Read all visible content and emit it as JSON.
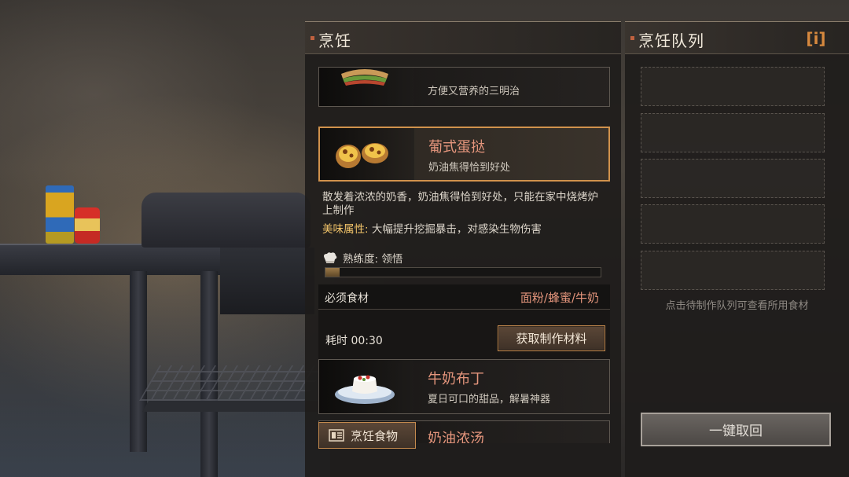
{
  "cooking_panel": {
    "title": "烹饪",
    "recipes": [
      {
        "name": "",
        "desc": "方便又营养的三明治"
      },
      {
        "name": "葡式蛋挞",
        "desc": "奶油焦得恰到好处"
      },
      {
        "name": "牛奶布丁",
        "desc": "夏日可口的甜品，解暑神器"
      },
      {
        "name": "奶油浓汤",
        "desc": ""
      }
    ],
    "detail": {
      "text": "散发着浓浓的奶香，奶油焦得恰到好处，只能在家中烧烤炉上制作",
      "attr_key": "美味属性:",
      "attr_value": " 大幅提升挖掘暴击，对感染生物伤害",
      "mastery": "熟练度: 领悟",
      "mastery_progress": 0.05
    },
    "ingredients_label": "必须食材",
    "ingredients_value": "面粉/蜂蜜/牛奶",
    "time_label": "耗时 00:30",
    "get_materials_label": "获取制作材料",
    "cook_button_label": "烹饪食物"
  },
  "queue_panel": {
    "title": "烹饪队列",
    "info_icon": "[i]",
    "hint": "点击待制作队列可查看所用食材",
    "recall_button_label": "一键取回"
  },
  "colors": {
    "accent": "#d1924c",
    "recipe_name": "#e4957c",
    "attr_key": "#f3c56a"
  }
}
